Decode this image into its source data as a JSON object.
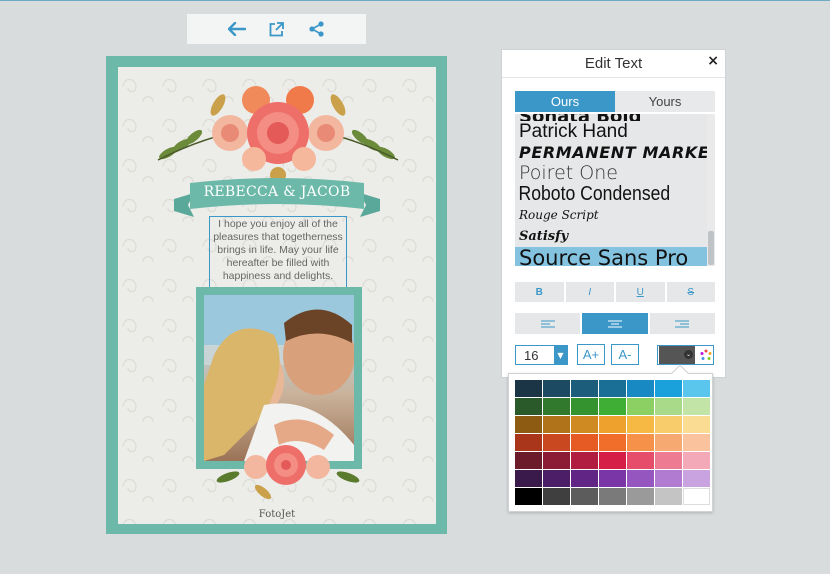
{
  "toolbar": {
    "back_icon": "arrow-left-icon",
    "open_icon": "external-link-icon",
    "share_icon": "share-icon"
  },
  "card": {
    "names": "REBECCA & JACOB",
    "message": "I hope you enjoy all of the pleasures that togetherness brings in life. May your life hereafter be filled with happiness and delights.",
    "watermark": "FotoJet"
  },
  "panel": {
    "title": "Edit Text",
    "close_label": "×",
    "tabs": [
      {
        "label": "Ours",
        "active": true
      },
      {
        "label": "Yours",
        "active": false
      }
    ],
    "fonts": [
      {
        "label": "Sonata Bold",
        "family": "\"DejaVu Sans\", sans-serif",
        "style": "bold",
        "cut": true
      },
      {
        "label": "Patrick Hand",
        "family": "\"Liberation Sans\", sans-serif",
        "style": "normal"
      },
      {
        "label": "Permanent Marker",
        "family": "\"DejaVu Sans\", sans-serif",
        "style": "marker"
      },
      {
        "label": "Poiret One",
        "family": "\"DejaVu Sans\", sans-serif",
        "style": "light"
      },
      {
        "label": "Roboto Condensed",
        "family": "\"Liberation Sans\", sans-serif",
        "style": "condensed"
      },
      {
        "label": "Rouge Script",
        "family": "\"DejaVu Serif\", serif",
        "style": "script"
      },
      {
        "label": "Satisfy",
        "family": "\"DejaVu Serif\", serif",
        "style": "script2"
      },
      {
        "label": "Source Sans Pro",
        "family": "\"DejaVu Sans\", sans-serif",
        "style": "selected"
      }
    ],
    "style_buttons": [
      "B",
      "I",
      "U",
      "S"
    ],
    "align_buttons": [
      "align-left",
      "align-center",
      "align-right"
    ],
    "active_align": "align-center",
    "font_size": "16",
    "increase_label": "A+",
    "decrease_label": "A-",
    "current_color": "#555555"
  },
  "palette": {
    "rows": [
      [
        "#1b3446",
        "#1d4a63",
        "#1c5d7c",
        "#1a6f97",
        "#1889c2",
        "#1aa1dc",
        "#5ac6ee"
      ],
      [
        "#2a5a2a",
        "#317a2d",
        "#35932f",
        "#3fae35",
        "#8ccf63",
        "#a9da8a",
        "#c2e4a7"
      ],
      [
        "#8e5b12",
        "#b0731a",
        "#d08a22",
        "#eea12c",
        "#f6b944",
        "#f8cc6a",
        "#fbdc93"
      ],
      [
        "#a9361b",
        "#c9481f",
        "#e65a24",
        "#f06d2a",
        "#f59149",
        "#f7a972",
        "#fac29d"
      ],
      [
        "#6b1b2a",
        "#8c1b36",
        "#b01d41",
        "#d51f47",
        "#e54d6b",
        "#ed7c92",
        "#f3a9b7"
      ],
      [
        "#3a1a4b",
        "#4c1e67",
        "#612586",
        "#7a35a6",
        "#9556bf",
        "#b07bd1",
        "#c9a2e0"
      ],
      [
        "#000000",
        "#3f3f3f",
        "#5c5c5c",
        "#7a7a7a",
        "#9a9a9a",
        "#c4c4c4",
        "#ffffff"
      ]
    ]
  }
}
